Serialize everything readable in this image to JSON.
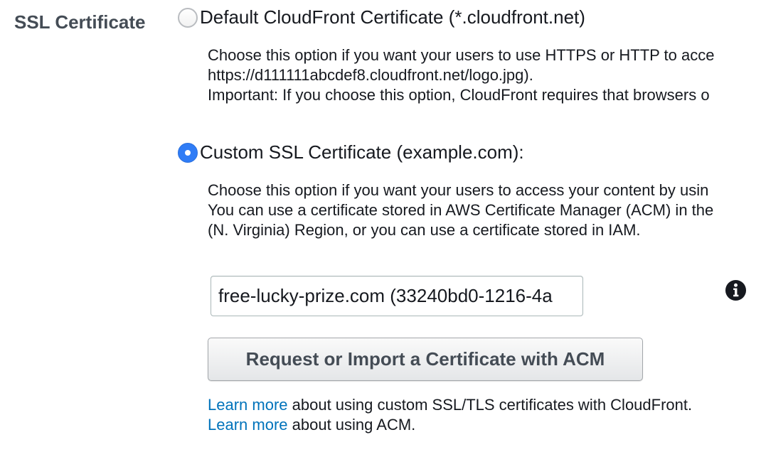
{
  "section": {
    "label": "SSL Certificate"
  },
  "options": [
    {
      "label": "Default CloudFront Certificate (*.cloudfront.net)",
      "selected": false,
      "description": [
        "Choose this option if you want your users to use HTTPS or HTTP to acce",
        "https://d111111abcdef8.cloudfront.net/logo.jpg).",
        "Important: If you choose this option, CloudFront requires that browsers o"
      ]
    },
    {
      "label": "Custom SSL Certificate (example.com):",
      "selected": true,
      "description": [
        "Choose this option if you want your users to access your content by usin",
        "You can use a certificate stored in AWS Certificate Manager (ACM) in the",
        "(N. Virginia) Region, or you can use a certificate stored in IAM."
      ]
    }
  ],
  "certificate_field": {
    "value": "free-lucky-prize.com (33240bd0-1216-4a"
  },
  "info_icon": "info-circle-icon",
  "acm_button": {
    "label": "Request or Import a Certificate with ACM"
  },
  "learn_more": [
    {
      "link": "Learn more",
      "text": " about using custom SSL/TLS certificates with CloudFront."
    },
    {
      "link": "Learn more",
      "text": " about using ACM."
    }
  ],
  "colors": {
    "link": "#0073bb",
    "radio_selected": "#2f7cf6",
    "label_gray": "#444c55"
  }
}
